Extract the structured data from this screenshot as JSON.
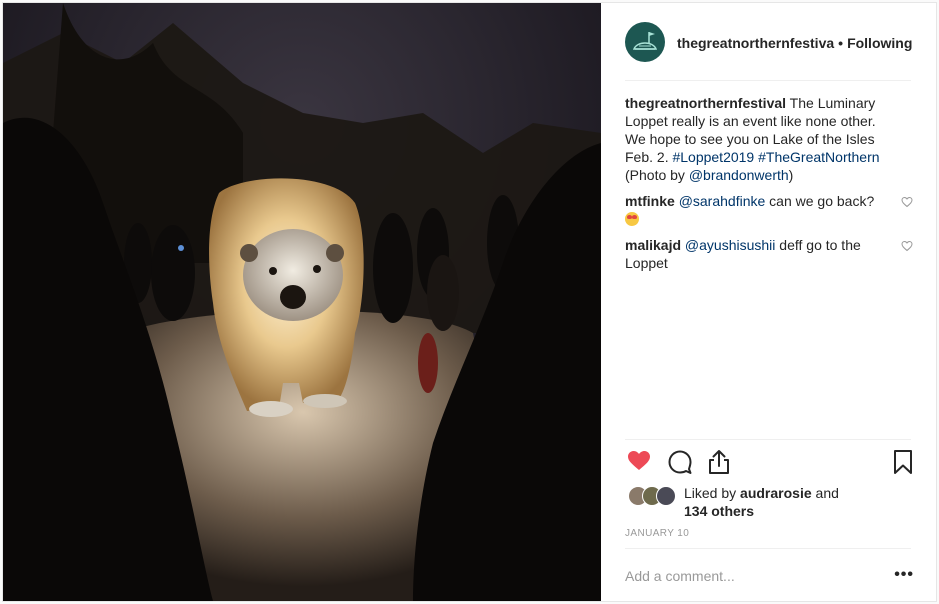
{
  "post": {
    "username": "thegreatnorthernfestiva",
    "dot": "•",
    "follow_label": "Following",
    "caption_user": "thegreatnorthernfestival",
    "caption_text": " The Luminary Loppet really is an event like none other. We hope to see you on Lake of the Isles Feb. 2. ",
    "caption_tag1": "#Loppet2019",
    "caption_tag2": "#TheGreatNorthern",
    "caption_text2": " (Photo by ",
    "caption_mention": "@brandonwerth",
    "caption_text3": ")",
    "date": "January 10",
    "add_comment_placeholder": "Add a comment...",
    "more_label": "•••"
  },
  "comments": [
    {
      "user": "mtfinke",
      "mention": "@sarahdfinke",
      "text": " can we go back? ",
      "emoji": "heart-eyes-emoji"
    },
    {
      "user": "malikajd",
      "mention": "@ayushisushii",
      "text": " deff go to the Loppet"
    }
  ],
  "likes": {
    "prefix": "Liked by ",
    "liker": "audrarosie",
    "and": " and",
    "others": "134 others"
  },
  "colors": {
    "like_red": "#ed4956",
    "link_blue": "#003569",
    "avatar_teal": "#1d5752"
  },
  "icons": [
    "heart-icon",
    "comment-icon",
    "share-icon",
    "bookmark-icon",
    "festival-logo-icon"
  ]
}
